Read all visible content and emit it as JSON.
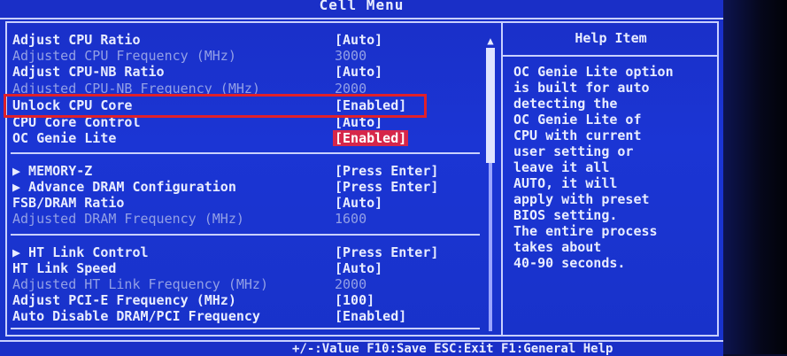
{
  "window": {
    "title": "Cell Menu"
  },
  "settings": [
    {
      "label": "Adjust CPU Ratio",
      "value": "[Auto]"
    },
    {
      "label": "Adjusted CPU Frequency (MHz)",
      "value": "3000"
    },
    {
      "label": "Adjust CPU-NB Ratio",
      "value": "[Auto]"
    },
    {
      "label": "Adjusted CPU-NB Frequency (MHz)",
      "value": "2000"
    },
    {
      "label": "Unlock CPU Core",
      "value": "[Enabled]"
    },
    {
      "label": "CPU Core Control",
      "value": "[Auto]"
    },
    {
      "label": "OC Genie Lite",
      "value": "[Enabled]"
    },
    {
      "label": "▶ MEMORY-Z",
      "value": "[Press Enter]"
    },
    {
      "label": "▶ Advance DRAM Configuration",
      "value": "[Press Enter]"
    },
    {
      "label": "FSB/DRAM Ratio",
      "value": "[Auto]"
    },
    {
      "label": "Adjusted DRAM Frequency (MHz)",
      "value": "1600"
    },
    {
      "label": "▶ HT Link Control",
      "value": "[Press Enter]"
    },
    {
      "label": "HT Link Speed",
      "value": "[Auto]"
    },
    {
      "label": "Adjusted HT Link Frequency (MHz)",
      "value": "2000"
    },
    {
      "label": "Adjust PCI-E Frequency (MHz)",
      "value": "[100]"
    },
    {
      "label": "Auto Disable DRAM/PCI Frequency",
      "value": "[Enabled]"
    }
  ],
  "help": {
    "title": "Help Item",
    "text": "OC Genie Lite option\nis built for auto\ndetecting the\nOC Genie Lite of\nCPU with current\nuser setting or\nleave it all\nAUTO, it will\napply with preset\nBIOS setting.\nThe entire process\ntakes about\n40-90 seconds."
  },
  "footer": {
    "text": "+/-:Value  F10:Save  ESC:Exit  F1:General Help"
  },
  "colors": {
    "background": "#1b35d4",
    "text": "#e8ecff",
    "disabled_text": "#93a0e6",
    "active_badge": "#d6264a",
    "highlight_box": "#e0202a"
  }
}
